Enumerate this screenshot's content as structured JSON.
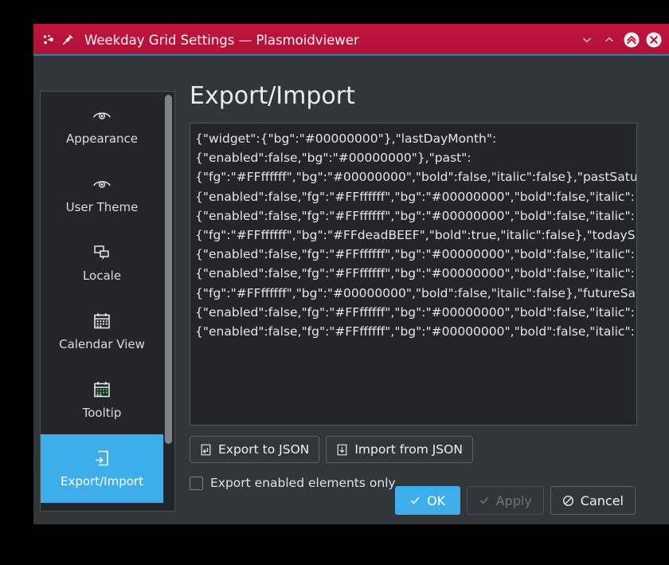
{
  "window": {
    "title": "Weekday Grid Settings — Plasmoidviewer",
    "app_icon": "plasmoid-icon",
    "pin_icon": "pin-icon",
    "controls": [
      {
        "name": "minimize-button",
        "icon": "chevron-down-icon"
      },
      {
        "name": "maximize-button",
        "icon": "chevron-up-icon"
      },
      {
        "name": "keep-above-button",
        "icon": "double-chevron-up-icon"
      },
      {
        "name": "close-button",
        "icon": "close-icon"
      }
    ],
    "titlebar_color": "#b21239",
    "accent_color": "#3daee9"
  },
  "sidebar": {
    "items": [
      {
        "label": "Appearance",
        "icon": "eye-icon",
        "selected": false
      },
      {
        "label": "User Theme",
        "icon": "eye-icon",
        "selected": false
      },
      {
        "label": "Locale",
        "icon": "speech-bubbles-icon",
        "selected": false
      },
      {
        "label": "Calendar View",
        "icon": "calendar-icon",
        "selected": false
      },
      {
        "label": "Tooltip",
        "icon": "calendar-green-icon",
        "selected": false
      },
      {
        "label": "Export/Import",
        "icon": "document-arrow-icon",
        "selected": true
      }
    ]
  },
  "main": {
    "page_title": "Export/Import",
    "json_lines": [
      "{\"widget\":{\"bg\":\"#00000000\"},\"lastDayMonth\":",
      "{\"enabled\":false,\"bg\":\"#00000000\"},\"past\":",
      "{\"fg\":\"#FFffffff\",\"bg\":\"#00000000\",\"bold\":false,\"italic\":false},\"pastSatu",
      "{\"enabled\":false,\"fg\":\"#FFffffff\",\"bg\":\"#00000000\",\"bold\":false,\"italic\":",
      "{\"enabled\":false,\"fg\":\"#FFffffff\",\"bg\":\"#00000000\",\"bold\":false,\"italic\":",
      "{\"fg\":\"#FFffffff\",\"bg\":\"#FFdeadBEEF\",\"bold\":true,\"italic\":false},\"todayS",
      "{\"enabled\":false,\"fg\":\"#FFffffff\",\"bg\":\"#00000000\",\"bold\":false,\"italic\":",
      "{\"enabled\":false,\"fg\":\"#FFffffff\",\"bg\":\"#00000000\",\"bold\":false,\"italic\":",
      "{\"fg\":\"#FFffffff\",\"bg\":\"#00000000\",\"bold\":false,\"italic\":false},\"futureSa",
      "{\"enabled\":false,\"fg\":\"#FFffffff\",\"bg\":\"#00000000\",\"bold\":false,\"italic\":",
      "{\"enabled\":false,\"fg\":\"#FFffffff\",\"bg\":\"#00000000\",\"bold\":false,\"italic\":"
    ],
    "export_button": "Export to JSON",
    "import_button": "Import from JSON",
    "checkbox_label": "Export enabled elements only",
    "checkbox_checked": false
  },
  "dialog_buttons": {
    "ok": "OK",
    "apply": "Apply",
    "cancel": "Cancel",
    "apply_disabled": true
  }
}
